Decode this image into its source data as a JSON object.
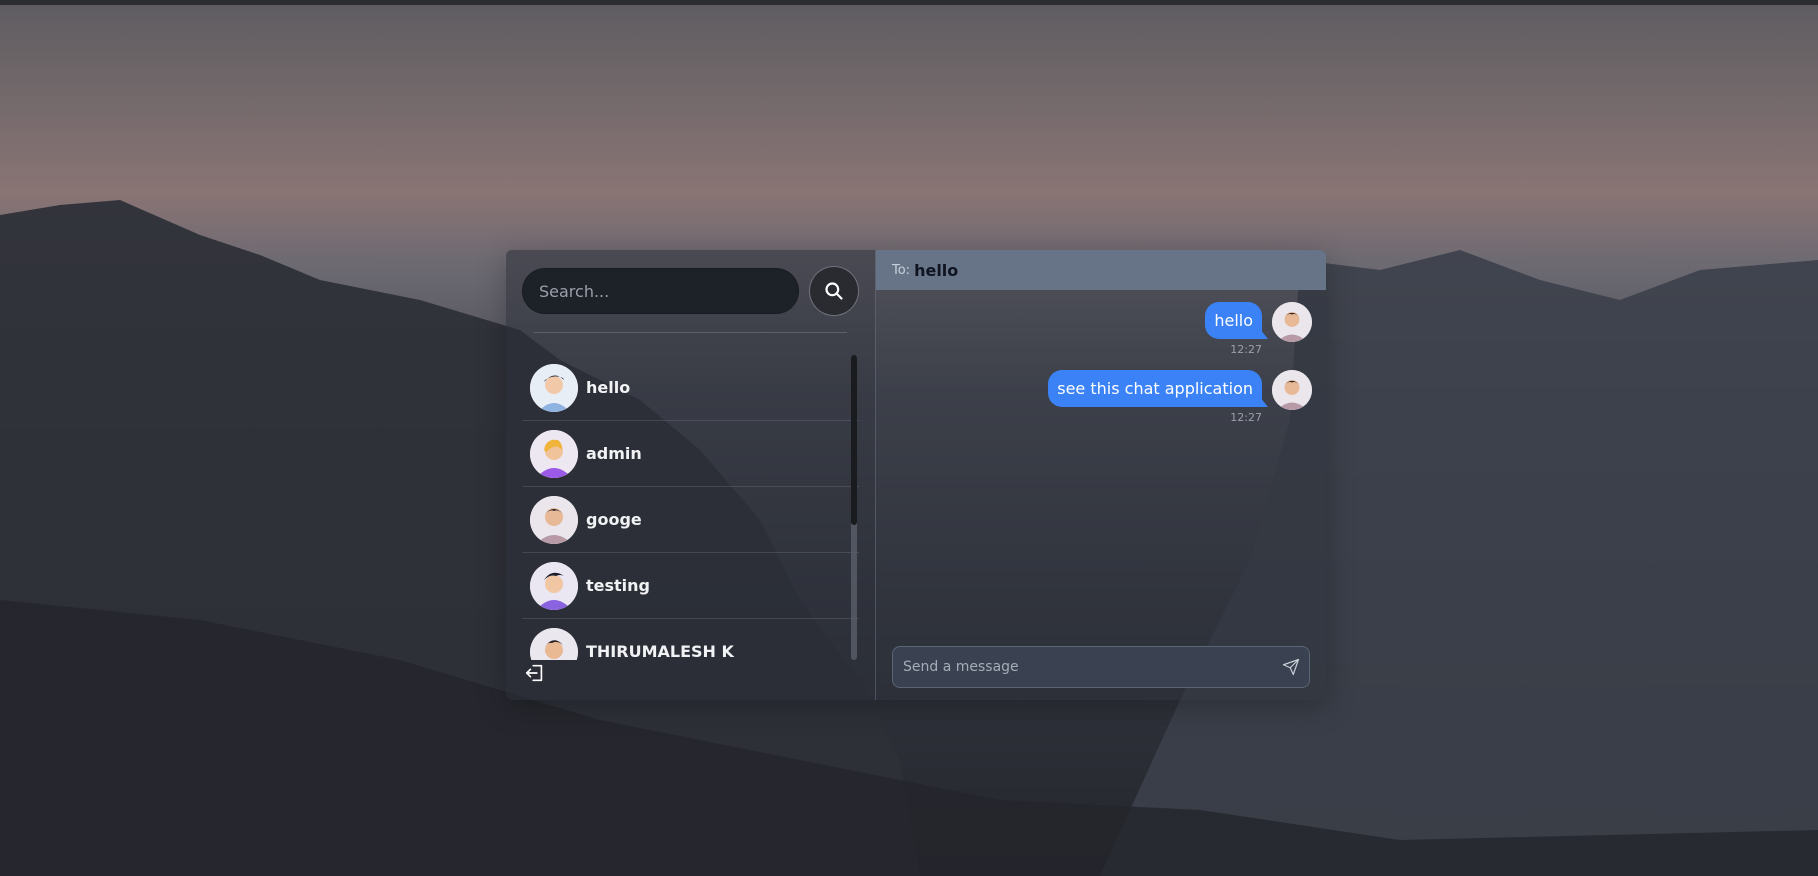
{
  "search": {
    "placeholder": "Search..."
  },
  "contacts": [
    {
      "name": "hello",
      "avatar": "avatar-man-blue-shirt"
    },
    {
      "name": "admin",
      "avatar": "avatar-woman-purple-shirt"
    },
    {
      "name": "googe",
      "avatar": "avatar-man-beard"
    },
    {
      "name": "testing",
      "avatar": "avatar-man-purple-shirt"
    },
    {
      "name": "THIRUMALESH K",
      "avatar": "avatar-man-dark-hair"
    }
  ],
  "chat": {
    "to_label": "To:",
    "to_name": "hello",
    "messages": [
      {
        "text": "hello",
        "time": "12:27"
      },
      {
        "text": "see this chat application",
        "time": "12:27"
      }
    ],
    "composer_placeholder": "Send a message"
  },
  "colors": {
    "bubble": "#3b82f6",
    "header": "#677488",
    "search_bg": "#1d2128"
  }
}
